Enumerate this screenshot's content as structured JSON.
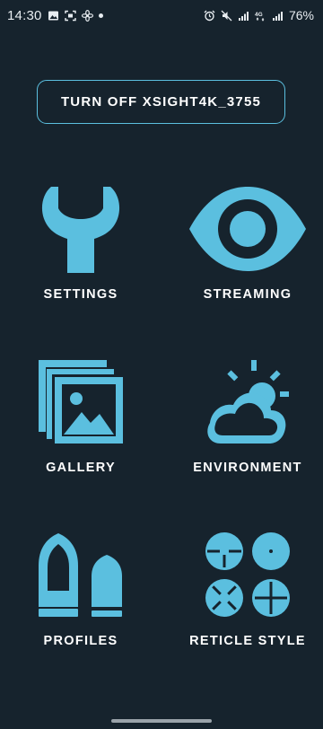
{
  "status_bar": {
    "time": "14:30",
    "battery": "76%",
    "left_icons": [
      "image-icon",
      "screenshot-icon",
      "fan-icon",
      "dot-icon"
    ],
    "right_icons": [
      "alarm-icon",
      "mute-icon",
      "signal-icon",
      "4g-icon",
      "signal-icon",
      "battery-icon"
    ]
  },
  "header": {
    "turn_off_label": "TURN OFF XSIGHT4K_3755"
  },
  "menu": {
    "settings": "SETTINGS",
    "streaming": "STREAMING",
    "gallery": "GALLERY",
    "environment": "ENVIRONMENT",
    "profiles": "PROFILES",
    "reticle_style": "RETICLE STYLE"
  },
  "colors": {
    "background": "#16232d",
    "accent": "#5bbfdf",
    "text": "#ffffff"
  }
}
